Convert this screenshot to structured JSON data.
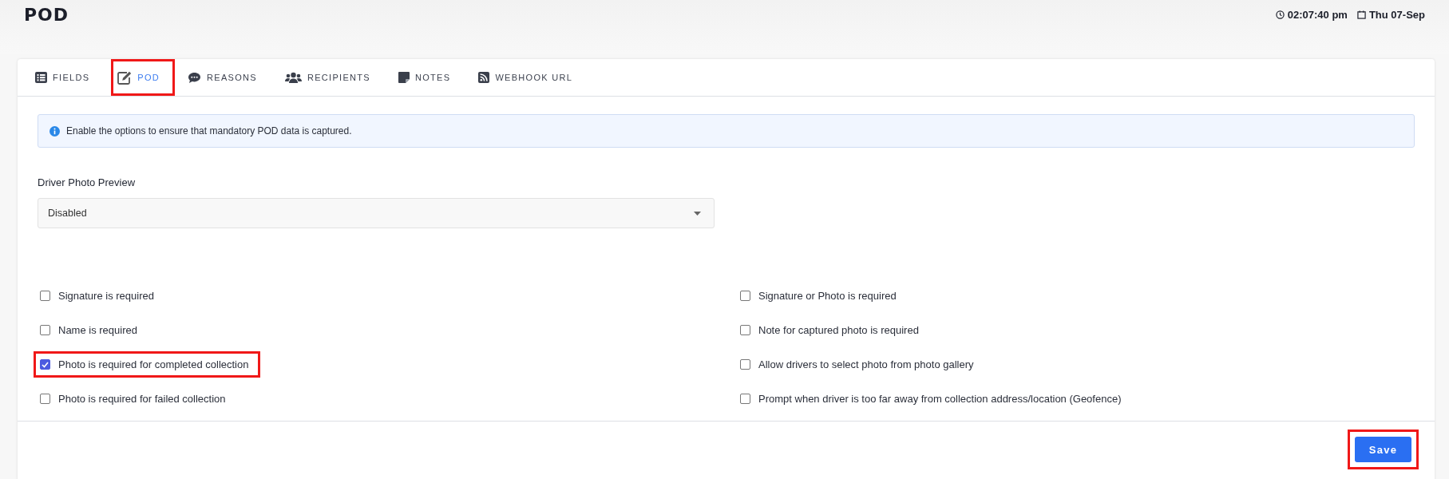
{
  "page": {
    "title": "POD",
    "time": "02:07:40 pm",
    "date": "Thu 07-Sep"
  },
  "tabs": [
    {
      "label": "FIELDS",
      "selected": false,
      "highlighted": false
    },
    {
      "label": "POD",
      "selected": true,
      "highlighted": true
    },
    {
      "label": "REASONS",
      "selected": false,
      "highlighted": false
    },
    {
      "label": "RECIPIENTS",
      "selected": false,
      "highlighted": false
    },
    {
      "label": "NOTES",
      "selected": false,
      "highlighted": false
    },
    {
      "label": "WEBHOOK URL",
      "selected": false,
      "highlighted": false
    }
  ],
  "alert": "Enable the options to ensure that mandatory POD data is captured.",
  "driver_photo_preview": {
    "label": "Driver Photo Preview",
    "value": "Disabled"
  },
  "options_left": [
    {
      "label": "Signature is required",
      "checked": false,
      "highlighted": false
    },
    {
      "label": "Name is required",
      "checked": false,
      "highlighted": false
    },
    {
      "label": "Photo is required for completed collection",
      "checked": true,
      "highlighted": true
    },
    {
      "label": "Photo is required for failed collection",
      "checked": false,
      "highlighted": false
    }
  ],
  "options_right": [
    {
      "label": "Signature or Photo is required",
      "checked": false,
      "highlighted": false
    },
    {
      "label": "Note for captured photo is required",
      "checked": false,
      "highlighted": false
    },
    {
      "label": "Allow drivers to select photo from photo gallery",
      "checked": false,
      "highlighted": false
    },
    {
      "label": "Prompt when driver is too far away from collection address/location (Geofence)",
      "checked": false,
      "highlighted": false
    }
  ],
  "save_button": {
    "label": "Save",
    "highlighted": true
  }
}
